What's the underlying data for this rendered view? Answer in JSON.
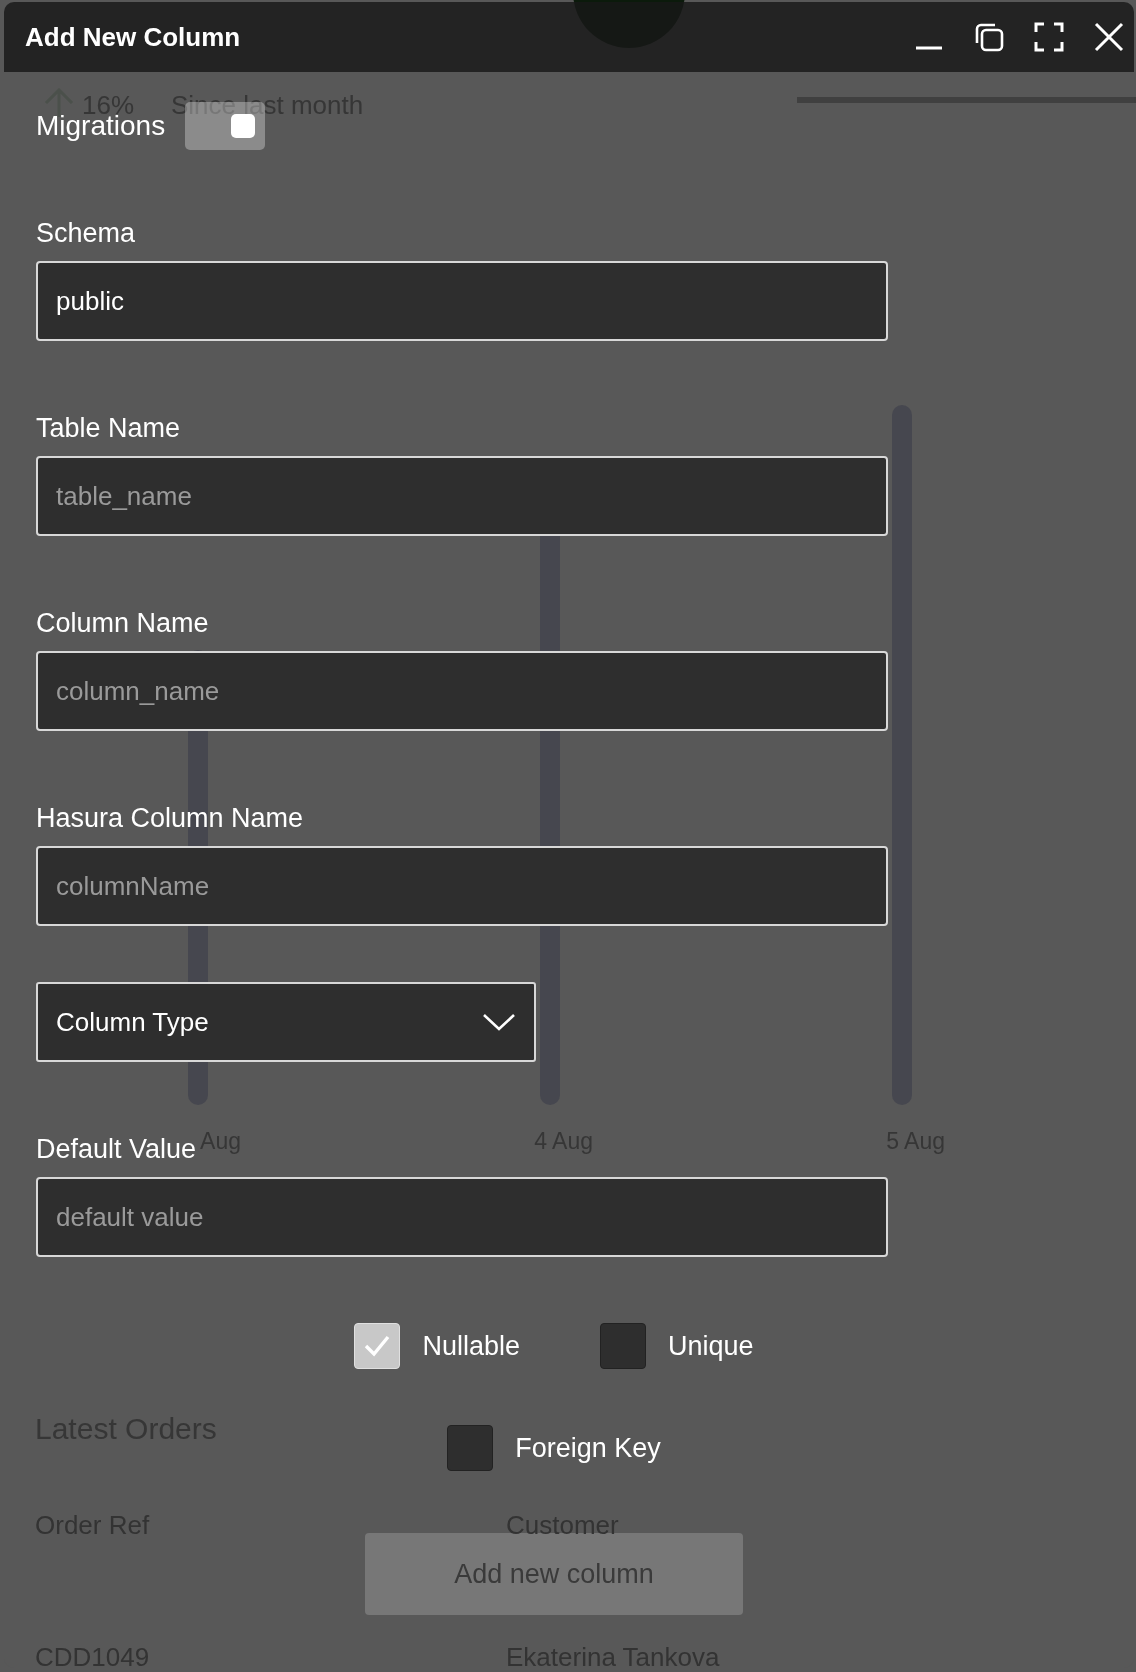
{
  "background": {
    "stat_change": "16%",
    "stat_caption": "Since last month",
    "chart_labels": [
      "Aug",
      "4 Aug",
      "5 Aug"
    ],
    "orders_title": "Latest Orders",
    "columns": [
      "Order Ref",
      "Customer"
    ],
    "rows": [
      [
        "CDD1049",
        "Ekaterina Tankova"
      ]
    ]
  },
  "window": {
    "title": "Add New Column"
  },
  "migrations": {
    "label": "Migrations",
    "on": true
  },
  "fields": [
    {
      "kind": "text",
      "label": "Schema",
      "value": "public"
    },
    {
      "kind": "text",
      "label": "Table Name",
      "placeholder": "table_name"
    },
    {
      "kind": "text",
      "label": "Column Name",
      "placeholder": "column_name"
    },
    {
      "kind": "text",
      "label": "Hasura Column Name",
      "placeholder": "columnName"
    },
    {
      "kind": "select",
      "value": "Column Type"
    },
    {
      "kind": "text",
      "label": "Default Value",
      "placeholder": "default value"
    }
  ],
  "checkboxes": [
    {
      "label": "Nullable",
      "checked": true
    },
    {
      "label": "Unique",
      "checked": false
    },
    {
      "label": "Foreign Key",
      "checked": false
    }
  ],
  "submit": {
    "label": "Add new column",
    "disabled": true
  }
}
